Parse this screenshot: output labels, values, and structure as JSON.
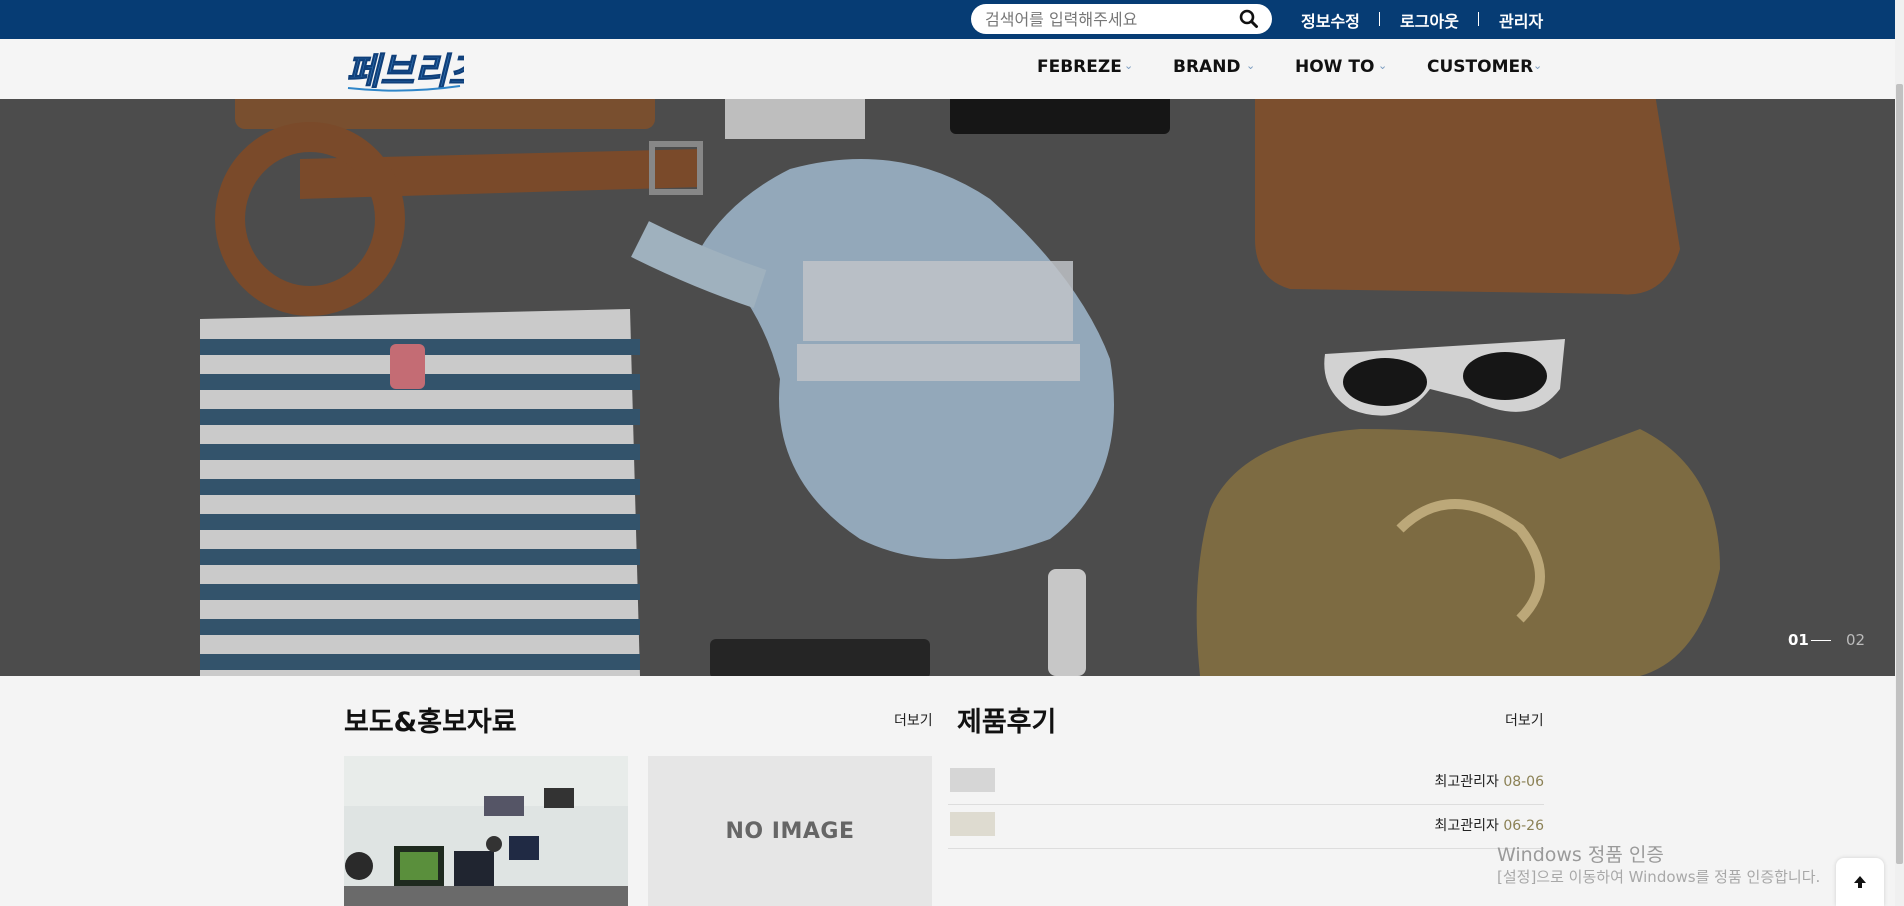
{
  "topbar": {
    "search_placeholder": "검색어를 입력해주세요",
    "links": [
      "정보수정",
      "로그아웃",
      "관리자"
    ]
  },
  "nav": {
    "logo_text": "페브리즈",
    "items": [
      "FEBREZE",
      "BRAND",
      "HOW TO",
      "CUSTOMER"
    ]
  },
  "hero": {
    "slides": [
      "01",
      "02"
    ],
    "active_slide": "01"
  },
  "press": {
    "title": "보도&홍보자료",
    "more": "더보기",
    "no_image": "NO IMAGE"
  },
  "reviews": {
    "title": "제품후기",
    "more": "더보기",
    "items": [
      {
        "author": "최고관리자",
        "date": "08-06"
      },
      {
        "author": "최고관리자",
        "date": "06-26"
      }
    ]
  },
  "windows_watermark": {
    "line1": "Windows 정품 인증",
    "line2": "[설정]으로 이동하여 Windows를 정품 인증합니다."
  },
  "colors": {
    "topbar": "#063c74",
    "accent_date": "#8b8155"
  }
}
